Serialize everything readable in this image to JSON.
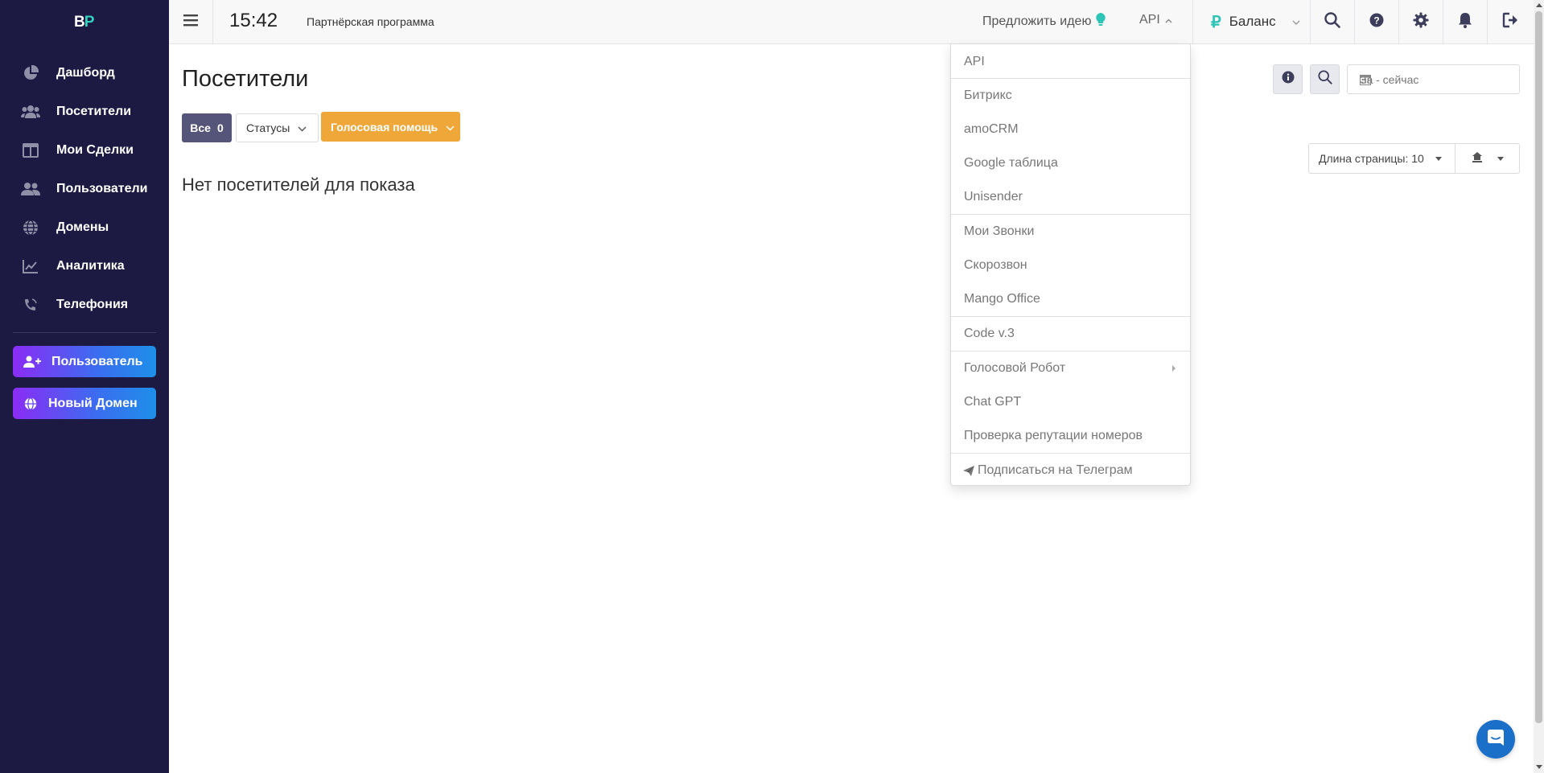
{
  "logo": {
    "b": "B",
    "p": "P"
  },
  "sidebar": {
    "items": [
      {
        "label": "Дашборд",
        "icon": "pie-chart-icon"
      },
      {
        "label": "Посетители",
        "icon": "users-icon"
      },
      {
        "label": "Мои Сделки",
        "icon": "columns-icon"
      },
      {
        "label": "Пользователи",
        "icon": "user-group-icon"
      },
      {
        "label": "Домены",
        "icon": "globe-icon"
      },
      {
        "label": "Аналитика",
        "icon": "line-chart-icon"
      },
      {
        "label": "Телефония",
        "icon": "phone-icon"
      }
    ],
    "add_user_label": "Пользователь",
    "new_domain_label": "Новый Домен"
  },
  "header": {
    "time": "15:42",
    "partner_label": "Партнёрская программа",
    "idea_label": "Предложить идею",
    "api_label": "API",
    "balance_symbol": "₽",
    "balance_label": "Баланс"
  },
  "main": {
    "title": "Посетители",
    "filter_all_label": "Все",
    "filter_all_count": "0",
    "filter_status_label": "Статусы",
    "voice_help_label": "Голосовая помощь",
    "empty_text": "Нет посетителей для показа",
    "date_placeholder": "За - сейчас",
    "page_length_label": "Длина страницы: 10"
  },
  "api_menu": {
    "items": [
      "API",
      "Битрикс",
      "amoCRM",
      "Google таблица",
      "Unisender",
      "Мои Звонки",
      "Скорозвон",
      "Mango Office",
      "Code v.3",
      "Голосовой Робот",
      "Chat GPT",
      "Проверка репутации номеров",
      "Подписаться на Телеграм"
    ]
  },
  "colors": {
    "sidebar_bg": "#1c1a43",
    "accent_teal": "#2ec4b6",
    "voice_btn": "#f0a73a",
    "filter_all_bg": "#55557a",
    "chat_bg": "#1a6fc9"
  }
}
